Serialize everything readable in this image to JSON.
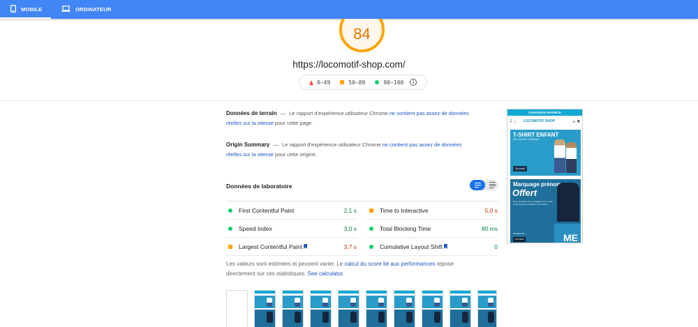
{
  "tabs": [
    {
      "label": "MOBILE",
      "icon": "smartphone-icon",
      "active": true
    },
    {
      "label": "ORDINATEUR",
      "icon": "laptop-icon",
      "active": false
    }
  ],
  "score": {
    "value": "84",
    "color": "#ffa400",
    "text_color": "#e67700"
  },
  "url": "https://locomotif-shop.com/",
  "legend": {
    "fail": "0–49",
    "average": "50–89",
    "pass": "90–100"
  },
  "field_data": {
    "title": "Données de terrain",
    "dash": "—",
    "text_before": "Le rapport d'expérience utilisateur Chrome",
    "link_line1": "ne contient pas assez de données",
    "link_line2": "réelles sur la vitesse",
    "text_after": "pour cette page."
  },
  "origin_summary": {
    "title": "Origin Summary",
    "dash": "—",
    "text_before": "Le rapport d'expérience utilisateur Chrome",
    "link_line1": "ne contient pas assez de données",
    "link_line2": "réelles sur la vitesse",
    "text_after": "pour cette origine."
  },
  "lab_data": {
    "title": "Données de laboratoire",
    "metrics_left": [
      {
        "name": "First Contentful Paint",
        "value": "2,1 s",
        "status": "good"
      },
      {
        "name": "Speed Index",
        "value": "3,0 s",
        "status": "good"
      },
      {
        "name": "Largest Contentful Paint",
        "value": "3,7 s",
        "status": "avg"
      }
    ],
    "metrics_right": [
      {
        "name": "Time to Interactive",
        "value": "5,0 s",
        "status": "avg"
      },
      {
        "name": "Total Blocking Time",
        "value": "80 ms",
        "status": "good"
      },
      {
        "name": "Cumulative Layout Shift",
        "value": "0",
        "status": "good"
      }
    ]
  },
  "note": {
    "text1": "Les valeurs sont estimées et peuvent varier. Le",
    "link1": "calcul du score lié aux performances",
    "text2": "repose",
    "text3": "directement sur ces statistiques.",
    "link2": "See calculator."
  },
  "preview": {
    "banner": "LIVRAISON OFFERTE",
    "logo": "LOCOMOTIF SHOP",
    "hero1_title": "T-SHIRT ENFANT",
    "hero1_sub": "UN CADEAU ORIGINAL",
    "hero1_button": "J'y cours",
    "hero2_title": "Marquage prénom",
    "hero2_big": "Offert",
    "hero2_text": "En poursuivant votre navigation sur ce site, vous acceptez l'utilisation de Cookies.",
    "hero2_button": "EN SAVOIR +",
    "hero2_button_b": "CROISER",
    "hero2_edge": "ME"
  },
  "colors": {
    "topbar": "#4285f4",
    "good": "#0cce6b",
    "average": "#ffa400",
    "fail": "#ff4e42",
    "link": "#1a55c4"
  }
}
